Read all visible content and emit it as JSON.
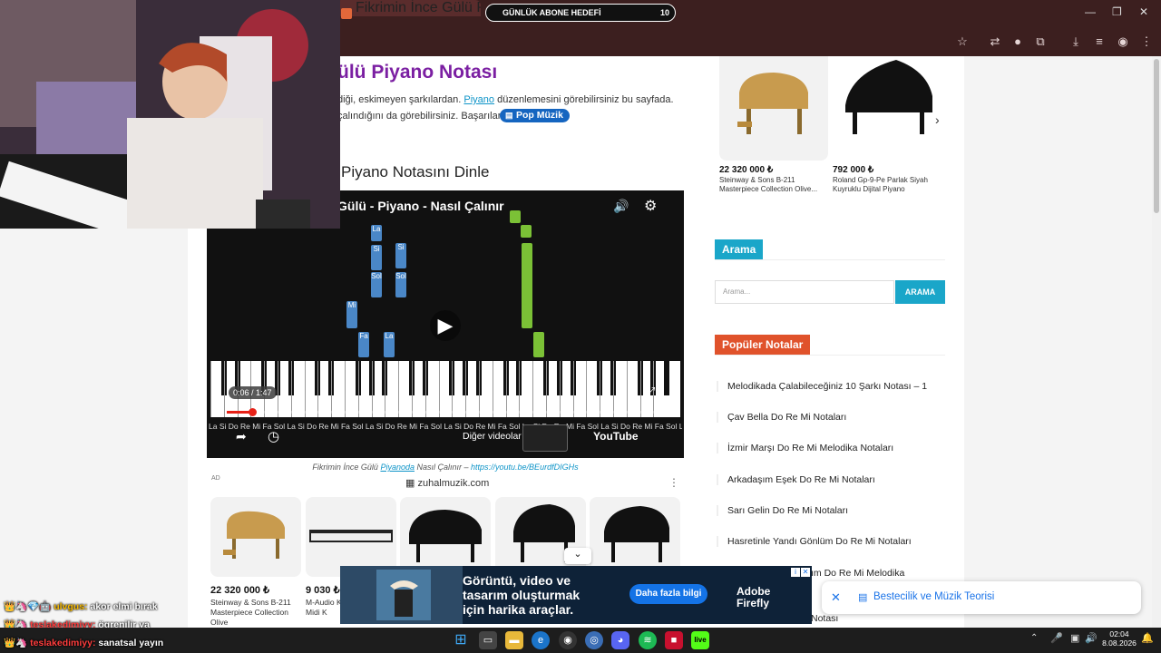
{
  "browser": {
    "tab_title": "Fikrimin İnce Gülü Piyano Notası",
    "overlay_goal": {
      "label": "GÜNLÜK ABONE HEDEFİ",
      "value": "10"
    }
  },
  "article": {
    "title": "ülü Piyano Notası",
    "intro_line1_a": "diği, eskimeyen şarkılardan.",
    "intro_link": "Piyano",
    "intro_line1_b": " düzenlemesini görebilirsiniz bu sayfada.",
    "intro_line2": "çalındığını da görebilirsiniz. Başarılar.",
    "tag": "Pop Müzik",
    "section_heading": "Piyano Notasını Dinle"
  },
  "video": {
    "title": "Gülü - Piyano - Nasıl Çalınır",
    "time_current": "0:06",
    "time_total": "1:47",
    "progress": 0.056,
    "more_videos": "Diğer videolar",
    "youtube": "YouTube",
    "key_labels": "La Si Do Re Mi Fa Sol La Si Do Re Mi Fa Sol La Si Do Re Mi Fa Sol La Si Do Re Mi Fa Sol La Si Do Re Mi Fa Sol La Si Do Re Mi Fa Sol La Si Do",
    "falling_notes": [
      "La",
      "Si",
      "Si",
      "Sol",
      "Sol",
      "Mi",
      "Fa",
      "La",
      "Fa"
    ]
  },
  "caption": {
    "prefix": "Fikrimin İnce Gülü",
    "link": "Piyanoda",
    "middle": " Nasıl Çalınır – ",
    "url": "https://youtu.be/BEurdfDIGHs"
  },
  "ad_products": {
    "ad_label": "AD",
    "domain": "zuhalmuzik.com",
    "items": [
      {
        "price": "22 320 000 ₺",
        "name": "Steinway & Sons B-211 Masterpiece Collection Olive"
      },
      {
        "price": "9 030 ₺",
        "name": "M-Audio Keystation Tuş Midi K"
      },
      {
        "price": "",
        "name": ""
      },
      {
        "price": "",
        "name": ""
      },
      {
        "price": "",
        "name": ""
      }
    ]
  },
  "sidebar": {
    "top_products": [
      {
        "price": "22 320 000 ₺",
        "name": "Steinway & Sons B-211 Masterpiece Collection Olive..."
      },
      {
        "price": "792 000 ₺",
        "name": "Roland Gp-9-Pe Parlak Siyah Kuyruklu Dijital Piyano"
      }
    ],
    "search_title": "Arama",
    "search_placeholder": "Arama...",
    "search_button": "ARAMA",
    "popular_title": "Popüler Notalar",
    "popular": [
      "Melodikada Çalabileceğiniz 10 Şarkı Notası – 1",
      "Çav Bella Do Re Mi Notaları",
      "İzmir Marşı Do Re Mi Melodika Notaları",
      "Arkadaşım Eşek Do Re Mi Notaları",
      "Sarı Gelin Do Re Mi Notaları",
      "Hasretinle Yandı Gönlüm Do Re Mi Notaları",
      "ım Do Re Mi Melodika",
      "Notası"
    ]
  },
  "chat": [
    {
      "user": "ulvgus:",
      "message": "akor elmi bırak"
    },
    {
      "user": "teslakedimiyy:",
      "message": "ögrenilir ya"
    },
    {
      "user": "teslakedimiyy:",
      "message": "sanatsal yayın"
    }
  ],
  "bottom_ad": {
    "text1": "Görüntü, video ve",
    "text2": "tasarım oluşturmak",
    "text3": "için harika araçlar.",
    "button": "Daha fazla bilgi",
    "brand1": "Adobe",
    "brand2": "Firefly"
  },
  "toast": {
    "text": "Bestecilik ve Müzik Teorisi"
  },
  "clock": {
    "time": "02:04",
    "date": "8.08.2026"
  },
  "colors": {
    "accent_title": "#7b1fa2",
    "search_widget": "#1aa6c9",
    "popular_widget": "#e0522b"
  }
}
